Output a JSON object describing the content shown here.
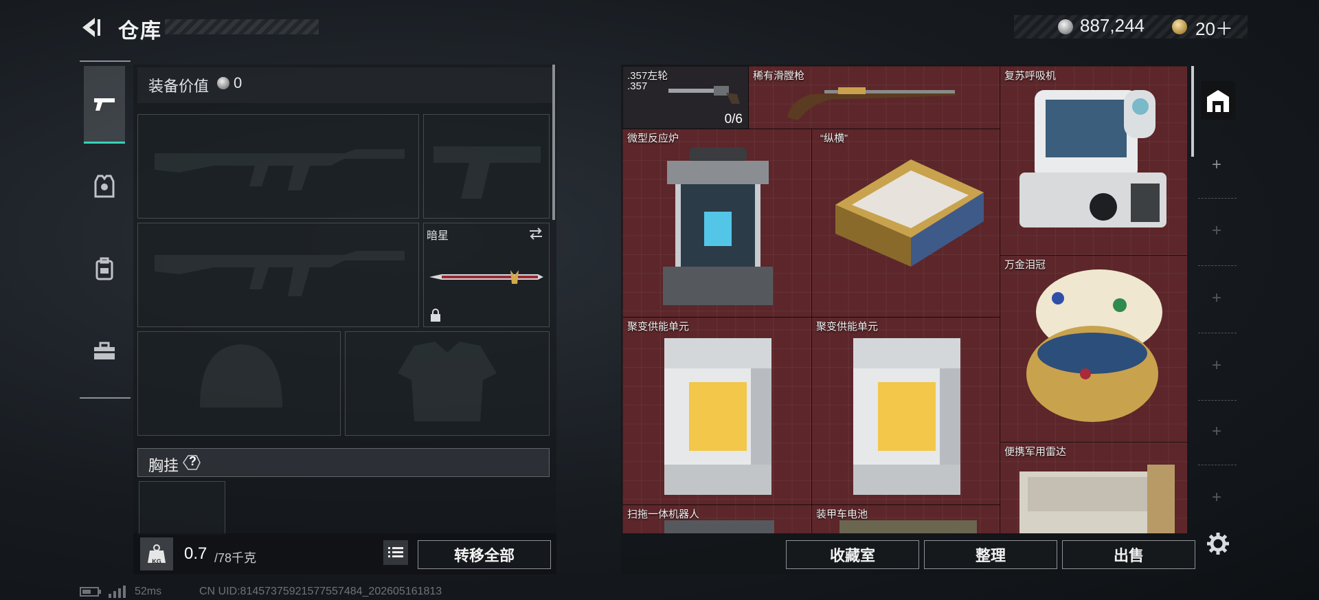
{
  "header": {
    "title": "仓库",
    "coins": "887,244",
    "tokens": "20＋",
    "note": ""
  },
  "tabs": [
    {
      "name": "weapons",
      "icon": "pistol-icon",
      "active": true
    },
    {
      "name": "armor",
      "icon": "armor-icon",
      "active": false
    },
    {
      "name": "backpack",
      "icon": "backpack-icon",
      "active": false
    },
    {
      "name": "toolbox",
      "icon": "toolbox-icon",
      "active": false
    }
  ],
  "equipment": {
    "value_label": "装备价值",
    "value": "0",
    "melee_name": "暗星",
    "chest_label": "胸挂",
    "help": "?",
    "weight_current": "0.7",
    "weight_max": "/78千克",
    "weight_icon": "KG",
    "transfer_label": "转移全部"
  },
  "storage": {
    "items": [
      {
        "label": ".357左轮",
        "sub": ".357",
        "count": "0/6"
      },
      {
        "label": "稀有滑膛枪"
      },
      {
        "label": "复苏呼吸机"
      },
      {
        "label": "微型反应炉"
      },
      {
        "label": "“纵横”"
      },
      {
        "label": "万金泪冠"
      },
      {
        "label": "聚变供能单元"
      },
      {
        "label": "聚变供能单元"
      },
      {
        "label": "便携军用雷达"
      },
      {
        "label": "扫拖一体机器人"
      },
      {
        "label": "装甲车电池"
      }
    ],
    "buttons": {
      "collection": "收藏室",
      "organize": "整理",
      "sell": "出售"
    }
  },
  "status": {
    "ping": "52ms",
    "uid": "CN UID:81457375921577557484_202605161813"
  },
  "colors": {
    "accent": "#38d1b7",
    "grid_bg": "#5c262a"
  }
}
